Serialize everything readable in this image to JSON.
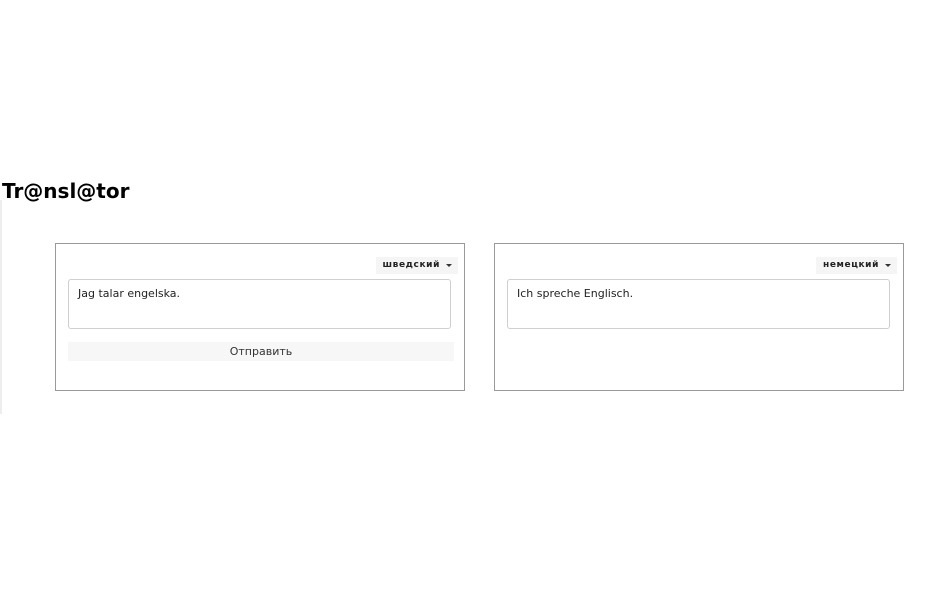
{
  "app": {
    "title": "Tr@nsl@tor"
  },
  "source": {
    "language": "шведский",
    "text": "Jag talar engelska.",
    "send_label": "Отправить"
  },
  "target": {
    "language": "немецкий",
    "text": "Ich spreche Englisch."
  },
  "icons": {
    "dropdown": "chevron-down-icon"
  },
  "colors": {
    "panel_border": "#9a9a9a",
    "text_box_border": "#cfcfcf",
    "button_background": "#f7f7f7",
    "select_background": "#f5f5f5"
  }
}
